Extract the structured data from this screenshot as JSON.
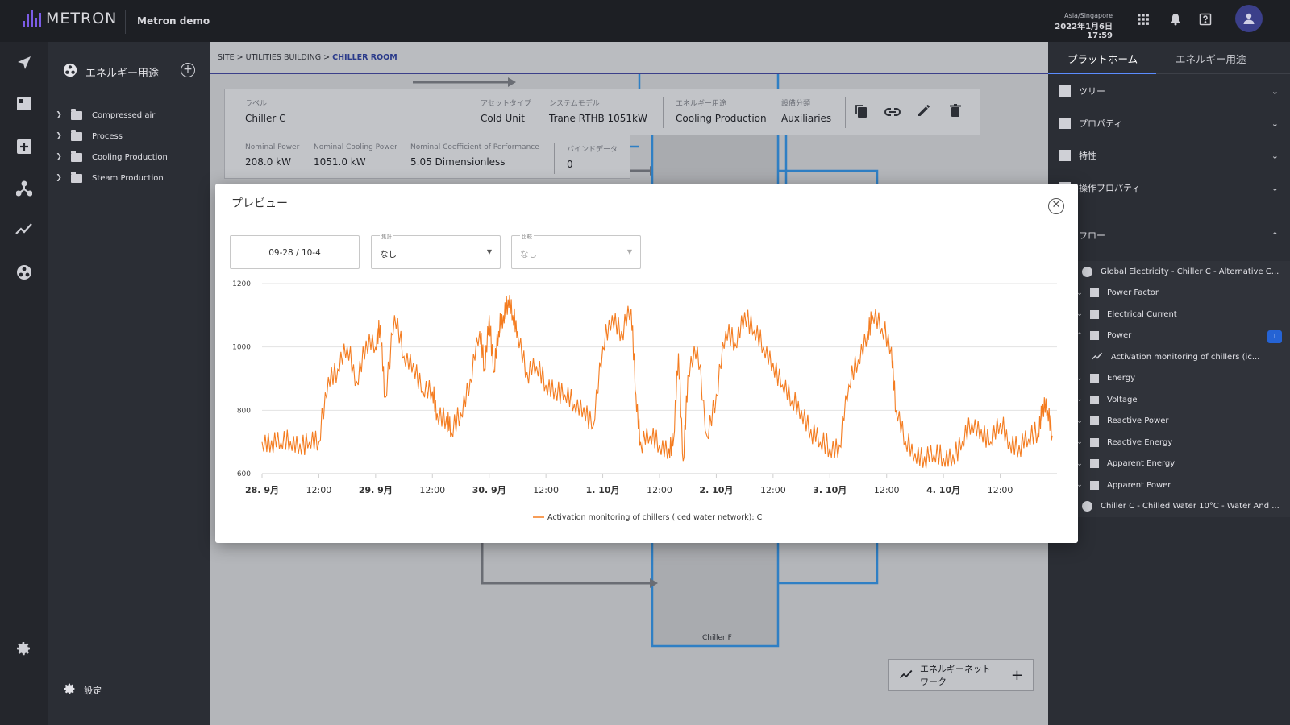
{
  "topbar": {
    "logo_text": "METRON",
    "org_name": "Metron demo",
    "timezone": "Asia/Singapore",
    "datetime": "2022年1月6日 17:59",
    "icons": [
      "apps-grid-icon",
      "bell-icon",
      "help-icon",
      "user-avatar-icon"
    ]
  },
  "left_rail": {
    "icons": [
      "navigate-icon",
      "dashboard-icon",
      "add-box-icon",
      "network-icon",
      "trend-icon",
      "energy-use-icon",
      "gear-icon"
    ]
  },
  "nav": {
    "title": "エネルギー用途",
    "items": [
      {
        "label": "Compressed air"
      },
      {
        "label": "Process"
      },
      {
        "label": "Cooling Production"
      },
      {
        "label": "Steam Production"
      }
    ],
    "settings_label": "設定"
  },
  "main": {
    "breadcrumb": {
      "root": "SITE",
      "sep": " > ",
      "mid": "UTILITIES BUILDING",
      "current": "CHILLER ROOM"
    },
    "asset_card": {
      "fields": [
        {
          "label": "ラベル",
          "value": "Chiller C"
        },
        {
          "label": "アセットタイプ",
          "value": "Cold Unit"
        },
        {
          "label": "システムモデル",
          "value": "Trane RTHB 1051kW"
        },
        {
          "label": "エネルギー用途",
          "value": "Cooling Production"
        },
        {
          "label": "設備分類",
          "value": "Auxiliaries"
        }
      ],
      "props": [
        {
          "label": "Nominal Power",
          "value": "208.0 kW"
        },
        {
          "label": "Nominal Cooling Power",
          "value": "1051.0 kW"
        },
        {
          "label": "Nominal Coefficient of Performance",
          "value": "5.05 Dimensionless"
        },
        {
          "label": "バインドデータ",
          "value": "0"
        }
      ]
    },
    "diagram_node_label": "Chiller F",
    "energy_network_label": "エネルギーネットワーク"
  },
  "right": {
    "tabs": [
      {
        "label": "プラットホーム",
        "active": true
      },
      {
        "label": "エネルギー用途",
        "active": false
      }
    ],
    "sections": [
      {
        "label": "ツリー"
      },
      {
        "label": "プロパティ"
      },
      {
        "label": "特性"
      },
      {
        "label": "操作プロパティ"
      }
    ],
    "flow_label": "フロー",
    "flow_items": [
      {
        "label": "Global Electricity - Chiller C - Alternative C...",
        "kind": "flow"
      },
      {
        "label": "Power Factor",
        "kind": "var"
      },
      {
        "label": "Electrical Current",
        "kind": "var"
      },
      {
        "label": "Power",
        "kind": "var",
        "badge": "1",
        "expanded": true
      },
      {
        "label": "Activation monitoring of chillers (ic...",
        "kind": "trend"
      },
      {
        "label": "Energy",
        "kind": "var"
      },
      {
        "label": "Voltage",
        "kind": "var"
      },
      {
        "label": "Reactive Power",
        "kind": "var"
      },
      {
        "label": "Reactive Energy",
        "kind": "var"
      },
      {
        "label": "Apparent Energy",
        "kind": "var"
      },
      {
        "label": "Apparent Power",
        "kind": "var"
      },
      {
        "label": "Chiller C - Chilled Water 10°C - Water And ...",
        "kind": "flow"
      }
    ]
  },
  "modal": {
    "title": "プレビュー",
    "date_range": "09-28 / 10-4",
    "aggregate_label": "集計",
    "aggregate_value": "なし",
    "compare_label": "比較",
    "compare_value": "なし"
  },
  "chart_data": {
    "type": "line",
    "title": "",
    "xlabel": "",
    "ylabel": "",
    "ylim": [
      600,
      1200
    ],
    "yticks": [
      600,
      800,
      1000,
      1200
    ],
    "xtick_labels": [
      "28. 9月",
      "12:00",
      "29. 9月",
      "12:00",
      "30. 9月",
      "12:00",
      "1. 10月",
      "12:00",
      "2. 10月",
      "12:00",
      "3. 10月",
      "12:00",
      "4. 10月",
      "12:00"
    ],
    "bold_xtick_indices": [
      0,
      2,
      4,
      6,
      8,
      10,
      12
    ],
    "x_hours_span": [
      0,
      168
    ],
    "grid": true,
    "legend_position": "bottom",
    "color": "#f47c20",
    "series": [
      {
        "name": "Activation monitoring of chillers (iced water network): C",
        "points": [
          [
            0,
            700
          ],
          [
            2,
            705
          ],
          [
            4,
            698
          ],
          [
            6,
            702
          ],
          [
            8,
            695
          ],
          [
            10,
            700
          ],
          [
            12,
            699
          ],
          [
            14,
            905
          ],
          [
            16,
            930
          ],
          [
            18,
            1000
          ],
          [
            20,
            890
          ],
          [
            22,
            1020
          ],
          [
            24,
            1000
          ],
          [
            25,
            1070
          ],
          [
            26,
            840
          ],
          [
            28,
            1100
          ],
          [
            30,
            970
          ],
          [
            32,
            950
          ],
          [
            34,
            860
          ],
          [
            36,
            860
          ],
          [
            37,
            790
          ],
          [
            39,
            780
          ],
          [
            40,
            730
          ],
          [
            42,
            790
          ],
          [
            44,
            900
          ],
          [
            46,
            1050
          ],
          [
            47,
            930
          ],
          [
            48,
            1100
          ],
          [
            49,
            920
          ],
          [
            50,
            1050
          ],
          [
            51,
            1100
          ],
          [
            52,
            1150
          ],
          [
            53,
            1100
          ],
          [
            54,
            1050
          ],
          [
            56,
            920
          ],
          [
            58,
            940
          ],
          [
            60,
            880
          ],
          [
            62,
            870
          ],
          [
            64,
            850
          ],
          [
            66,
            820
          ],
          [
            68,
            810
          ],
          [
            70,
            750
          ],
          [
            72,
            1000
          ],
          [
            74,
            1100
          ],
          [
            76,
            1050
          ],
          [
            78,
            1120
          ],
          [
            79,
            850
          ],
          [
            80,
            700
          ],
          [
            82,
            720
          ],
          [
            84,
            690
          ],
          [
            86,
            680
          ],
          [
            87,
            710
          ],
          [
            88,
            980
          ],
          [
            89,
            640
          ],
          [
            90,
            910
          ],
          [
            92,
            1000
          ],
          [
            94,
            720
          ],
          [
            96,
            850
          ],
          [
            98,
            1050
          ],
          [
            100,
            1010
          ],
          [
            102,
            1110
          ],
          [
            104,
            1050
          ],
          [
            106,
            1000
          ],
          [
            108,
            950
          ],
          [
            110,
            880
          ],
          [
            112,
            830
          ],
          [
            114,
            800
          ],
          [
            116,
            740
          ],
          [
            118,
            700
          ],
          [
            120,
            680
          ],
          [
            122,
            690
          ],
          [
            124,
            880
          ],
          [
            126,
            960
          ],
          [
            128,
            1050
          ],
          [
            129,
            1100
          ],
          [
            131,
            1060
          ],
          [
            133,
            1000
          ],
          [
            134,
            800
          ],
          [
            136,
            700
          ],
          [
            138,
            665
          ],
          [
            140,
            655
          ],
          [
            142,
            660
          ],
          [
            144,
            650
          ],
          [
            146,
            660
          ],
          [
            148,
            700
          ],
          [
            150,
            760
          ],
          [
            152,
            740
          ],
          [
            154,
            700
          ],
          [
            156,
            760
          ],
          [
            158,
            700
          ],
          [
            160,
            690
          ],
          [
            162,
            710
          ],
          [
            164,
            730
          ],
          [
            165,
            820
          ],
          [
            166,
            800
          ],
          [
            167,
            720
          ]
        ]
      }
    ]
  }
}
